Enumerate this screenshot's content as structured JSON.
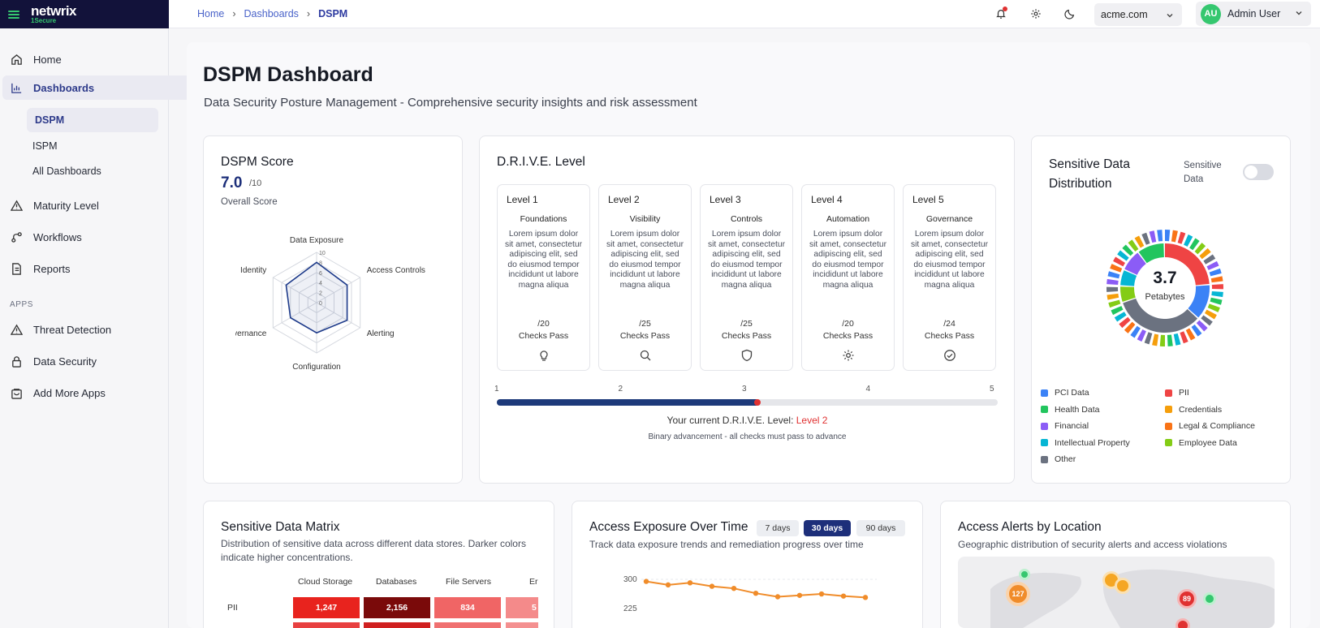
{
  "brand": {
    "name": "netwrix",
    "product": "1Secure"
  },
  "sidebar": {
    "items": [
      {
        "label": "Home",
        "icon": "home-icon"
      },
      {
        "label": "Dashboards",
        "icon": "bar-chart-icon"
      },
      {
        "label": "Maturity Level",
        "icon": "warning-icon"
      },
      {
        "label": "Workflows",
        "icon": "workflow-icon"
      },
      {
        "label": "Reports",
        "icon": "report-icon"
      }
    ],
    "dashboard_sub": [
      "DSPM",
      "ISPM",
      "All Dashboards"
    ],
    "apps_label": "APPS",
    "apps": [
      {
        "label": "Threat Detection",
        "icon": "warning-icon"
      },
      {
        "label": "Data Security",
        "icon": "lock-icon"
      },
      {
        "label": "Add More Apps",
        "icon": "bag-icon"
      }
    ]
  },
  "header": {
    "breadcrumb": [
      "Home",
      "Dashboards",
      "DSPM"
    ],
    "domain": "acme.com",
    "user": {
      "initials": "AU",
      "name": "Admin User"
    }
  },
  "page": {
    "title": "DSPM Dashboard",
    "subtitle": "Data Security Posture Management - Comprehensive security insights and risk assessment"
  },
  "dspm_score": {
    "title": "DSPM Score",
    "value": "7.0",
    "max": "/10",
    "label": "Overall Score",
    "radar_axes": [
      "Data Exposure",
      "Access Controls",
      "Alerting",
      "Configuration",
      "Governance",
      "Identity"
    ],
    "radar_ticks": [
      "10",
      "8",
      "6",
      "4",
      "2",
      "0"
    ],
    "radar_values": [
      8,
      7,
      7,
      6,
      6,
      7
    ]
  },
  "drive": {
    "title": "D.R.I.V.E. Level",
    "levels": [
      {
        "title": "Level 1",
        "name": "Foundations",
        "desc": "Lorem ipsum dolor sit amet, consectetur adipiscing elit, sed do eiusmod tempor incididunt ut labore magna aliqua",
        "checks": "/20",
        "checks_label": "Checks Pass",
        "icon": "lightbulb-icon"
      },
      {
        "title": "Level 2",
        "name": "Visibility",
        "desc": "Lorem ipsum dolor sit amet, consectetur adipiscing elit, sed do eiusmod tempor incididunt ut labore magna aliqua",
        "checks": "/25",
        "checks_label": "Checks Pass",
        "icon": "search-icon"
      },
      {
        "title": "Level 3",
        "name": "Controls",
        "desc": "Lorem ipsum dolor sit amet, consectetur adipiscing elit, sed do eiusmod tempor incididunt ut labore magna aliqua",
        "checks": "/25",
        "checks_label": "Checks Pass",
        "icon": "shield-icon"
      },
      {
        "title": "Level 4",
        "name": "Automation",
        "desc": "Lorem ipsum dolor sit amet, consectetur adipiscing elit, sed do eiusmod tempor incididunt ut labore magna aliqua",
        "checks": "/20",
        "checks_label": "Checks Pass",
        "icon": "gear-icon"
      },
      {
        "title": "Level 5",
        "name": "Governance",
        "desc": "Lorem ipsum dolor sit amet, consectetur adipiscing elit, sed do eiusmod tempor incididunt ut labore magna aliqua",
        "checks": "/24",
        "checks_label": "Checks Pass",
        "icon": "check-circle-icon"
      }
    ],
    "ticks": [
      "1",
      "2",
      "3",
      "4",
      "5"
    ],
    "progress_fraction": 0.52,
    "current_text": "Your current D.R.I.V.E. Level:",
    "current_level": "Level 2",
    "note": "Binary advancement - all checks must pass to advance"
  },
  "sensitive_dist": {
    "title": "Sensitive Data Distribution",
    "toggle_label": "Sensitive Data",
    "total": "3.7",
    "unit": "Petabytes",
    "legend": [
      {
        "label": "PCI Data",
        "color": "#3b82f6"
      },
      {
        "label": "PII",
        "color": "#ef4444"
      },
      {
        "label": "Health Data",
        "color": "#22c55e"
      },
      {
        "label": "Credentials",
        "color": "#f59e0b"
      },
      {
        "label": "Financial",
        "color": "#8b5cf6"
      },
      {
        "label": "Legal & Compliance",
        "color": "#f97316"
      },
      {
        "label": "Intellectual Property",
        "color": "#06b6d4"
      },
      {
        "label": "Employee Data",
        "color": "#84cc16"
      },
      {
        "label": "Other",
        "color": "#6b7280"
      }
    ]
  },
  "matrix": {
    "title": "Sensitive Data Matrix",
    "desc": "Distribution of sensitive data across different data stores. Darker colors indicate higher concentrations.",
    "columns": [
      "Cloud Storage",
      "Databases",
      "File Servers",
      "Er"
    ],
    "rows": [
      {
        "label": "PII",
        "values": [
          "1,247",
          "2,156",
          "834",
          "5"
        ]
      }
    ]
  },
  "exposure": {
    "title": "Access Exposure Over Time",
    "ranges": [
      "7 days",
      "30 days",
      "90 days"
    ],
    "desc": "Track data exposure trends and remediation progress over time",
    "y_ticks": [
      "300",
      "225"
    ]
  },
  "chart_data": {
    "type": "line",
    "title": "Access Exposure Over Time",
    "x": [
      1,
      2,
      3,
      4,
      5,
      6,
      7,
      8,
      9,
      10,
      11
    ],
    "series": [
      {
        "values": [
          297,
          292,
          295,
          290,
          287,
          280,
          275,
          277,
          279,
          276,
          274
        ]
      }
    ],
    "ylim": [
      200,
      300
    ]
  },
  "alerts": {
    "title": "Access Alerts by Location",
    "desc": "Geographic distribution of security alerts and access violations",
    "markers": [
      "127",
      "89"
    ]
  }
}
